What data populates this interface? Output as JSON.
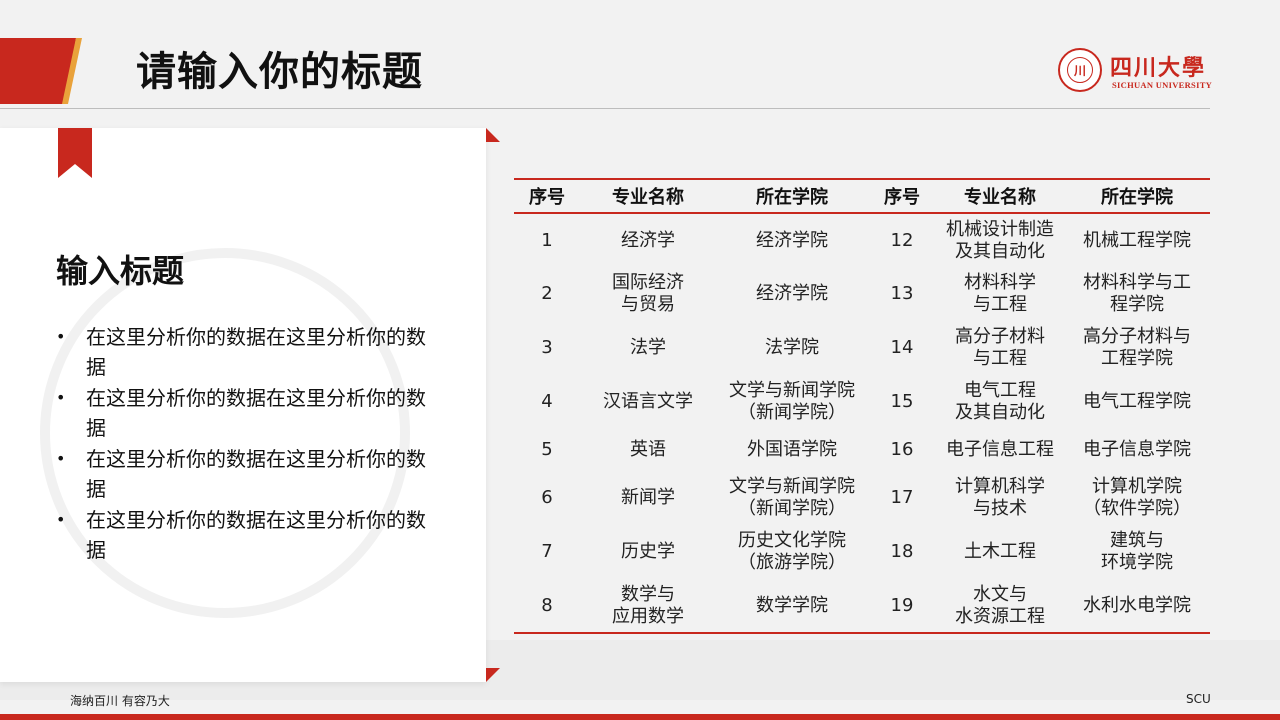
{
  "slide": {
    "title": "请输入你的标题"
  },
  "logo": {
    "cn": "四川大學",
    "en": "SICHUAN UNIVERSITY"
  },
  "left_panel": {
    "heading": "输入标题",
    "bullets": [
      "在这里分析你的数据在这里分析你的数据",
      "在这里分析你的数据在这里分析你的数据",
      "在这里分析你的数据在这里分析你的数据",
      "在这里分析你的数据在这里分析你的数据"
    ]
  },
  "table": {
    "headers": [
      "序号",
      "专业名称",
      "所在学院",
      "序号",
      "专业名称",
      "所在学院"
    ],
    "rows": [
      [
        "1",
        "经济学",
        "经济学院",
        "12",
        "机械设计制造\n及其自动化",
        "机械工程学院"
      ],
      [
        "2",
        "国际经济\n与贸易",
        "经济学院",
        "13",
        "材料科学\n与工程",
        "材料科学与工\n程学院"
      ],
      [
        "3",
        "法学",
        "法学院",
        "14",
        "高分子材料\n与工程",
        "高分子材料与\n工程学院"
      ],
      [
        "4",
        "汉语言文学",
        "文学与新闻学院\n（新闻学院）",
        "15",
        "电气工程\n及其自动化",
        "电气工程学院"
      ],
      [
        "5",
        "英语",
        "外国语学院",
        "16",
        "电子信息工程",
        "电子信息学院"
      ],
      [
        "6",
        "新闻学",
        "文学与新闻学院\n（新闻学院）",
        "17",
        "计算机科学\n与技术",
        "计算机学院\n（软件学院）"
      ],
      [
        "7",
        "历史学",
        "历史文化学院\n（旅游学院）",
        "18",
        "土木工程",
        "建筑与\n环境学院"
      ],
      [
        "8",
        "数学与\n应用数学",
        "数学学院",
        "19",
        "水文与\n水资源工程",
        "水利水电学院"
      ]
    ]
  },
  "footer": {
    "left": "海纳百川  有容乃大",
    "right": "SCU"
  },
  "colors": {
    "accent": "#c8281e",
    "secondary_accent": "#e9a23b"
  }
}
